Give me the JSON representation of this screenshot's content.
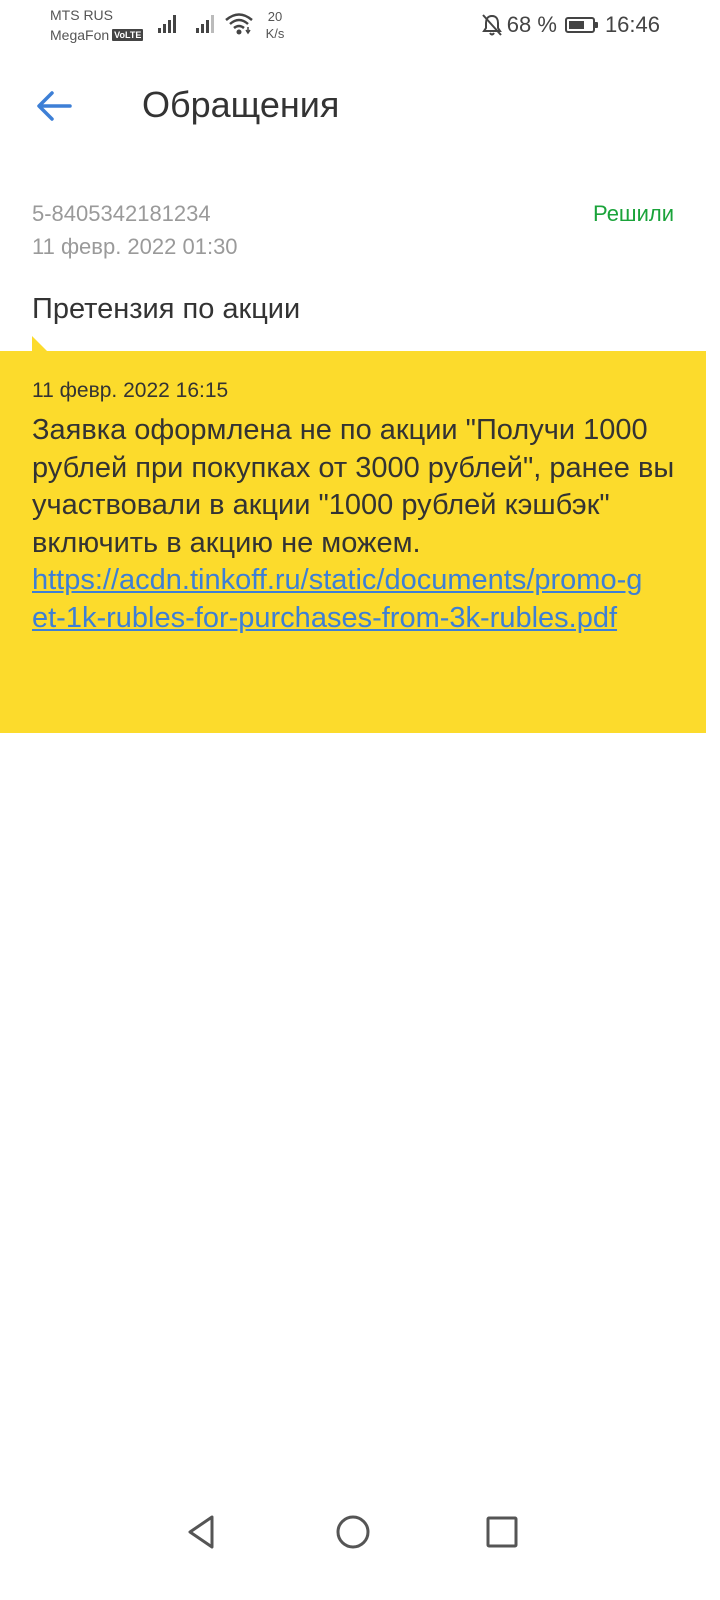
{
  "status_bar": {
    "carrier1": "MTS RUS",
    "carrier2": "MegaFon",
    "volte": "VoLTE",
    "net_speed_value": "20",
    "net_speed_unit": "K/s",
    "battery_text": "68 %",
    "battery_level": 0.68,
    "time": "16:46"
  },
  "header": {
    "title": "Обращения"
  },
  "ticket": {
    "id": "5-8405342181234",
    "date": "11 февр. 2022 01:30",
    "status": "Решили",
    "status_color": "#1aa33a",
    "subject": "Претензия по акции"
  },
  "message": {
    "date": "11 февр. 2022 16:15",
    "text": "Заявка оформлена не по акции \"Получи 1000 рублей при покупках от 3000 рублей\", ранее вы участвовали в акции \"1000 рублей кэшбэк\" включить в акцию не можем.",
    "link": "https://acdn.tinkoff.ru/static/documents/promo-get-1k-rubles-for-purchases-from-3k-rubles.pdf",
    "bubble_color": "#fcdb2c"
  },
  "nav": {
    "back": "back-triangle-icon",
    "home": "home-circle-icon",
    "recents": "recents-square-icon"
  }
}
